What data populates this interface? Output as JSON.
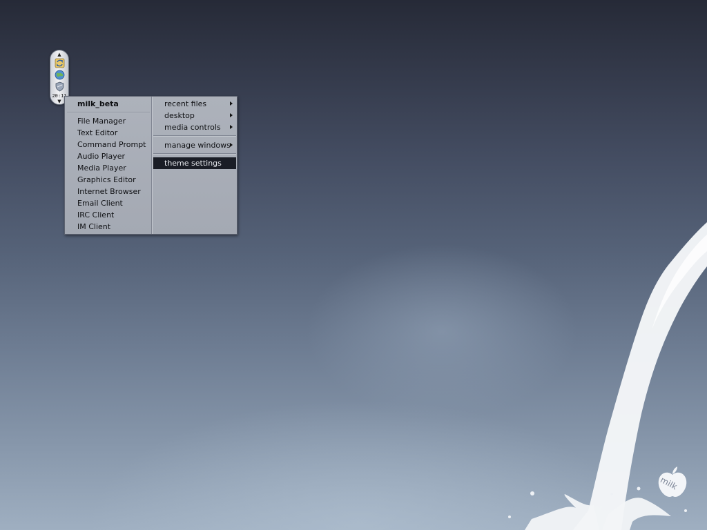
{
  "launcher": {
    "clock": "20:11",
    "icons": [
      "refresh-icon",
      "globe-icon",
      "shield-icon"
    ]
  },
  "menu": {
    "title": "milk_beta",
    "apps": [
      "File Manager",
      "Text Editor",
      "Command Prompt",
      "Audio Player",
      "Media Player",
      "Graphics Editor",
      "Internet Browser",
      "Email Client",
      "IRC Client",
      "IM Client"
    ],
    "submenus": {
      "recent_files": "recent files",
      "desktop": "desktop",
      "media_controls": "media controls",
      "manage_windows": "manage windows",
      "theme_settings": "theme settings"
    }
  },
  "wallpaper": {
    "logo_text": "milk"
  },
  "colors": {
    "menu_bg": "#a9aeb7",
    "selection": "#1a1d26"
  }
}
